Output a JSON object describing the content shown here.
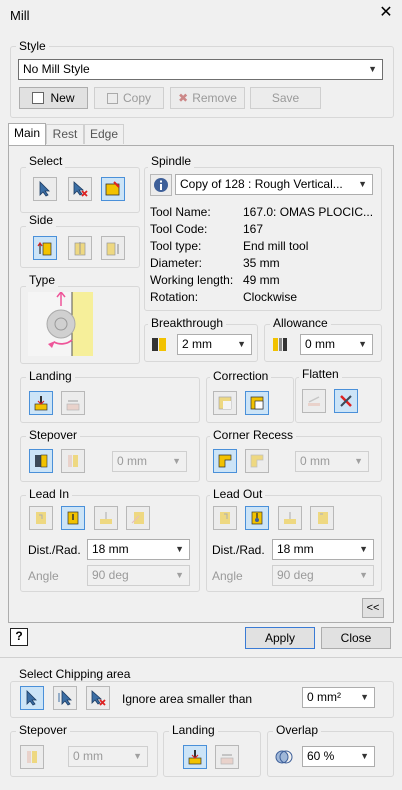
{
  "window": {
    "title": "Mill",
    "close": "✕"
  },
  "style": {
    "label": "Style",
    "selected": "No Mill Style",
    "buttons": {
      "new": "New",
      "copy": "Copy",
      "remove": "Remove",
      "save": "Save"
    }
  },
  "tabs": [
    "Main",
    "Rest",
    "Edge"
  ],
  "select": {
    "label": "Select"
  },
  "side": {
    "label": "Side"
  },
  "type": {
    "label": "Type"
  },
  "spindle": {
    "label": "Spindle",
    "tool_selected": "Copy of 128 : Rough Vertical...",
    "info": [
      {
        "k": "Tool Name:",
        "v": "167.0: OMAS PLOCIC..."
      },
      {
        "k": "Tool Code:",
        "v": "167"
      },
      {
        "k": "Tool type:",
        "v": "End mill tool"
      },
      {
        "k": "Diameter:",
        "v": "35 mm"
      },
      {
        "k": "Working length:",
        "v": "49 mm"
      },
      {
        "k": "Rotation:",
        "v": "Clockwise"
      }
    ]
  },
  "breakthrough": {
    "label": "Breakthrough",
    "value": "2 mm"
  },
  "allowance": {
    "label": "Allowance",
    "value": "0 mm"
  },
  "landing": {
    "label": "Landing"
  },
  "correction": {
    "label": "Correction"
  },
  "flatten": {
    "label": "Flatten"
  },
  "stepover": {
    "label": "Stepover",
    "value": "0 mm"
  },
  "corner_recess": {
    "label": "Corner Recess",
    "value": "0 mm"
  },
  "lead_in": {
    "label": "Lead In",
    "dist_label": "Dist./Rad.",
    "dist_value": "18 mm",
    "angle_label": "Angle",
    "angle_value": "90 deg"
  },
  "lead_out": {
    "label": "Lead Out",
    "dist_label": "Dist./Rad.",
    "dist_value": "18 mm",
    "angle_label": "Angle",
    "angle_value": "90 deg"
  },
  "collapse": "<<",
  "help": "?",
  "apply": "Apply",
  "close": "Close",
  "chipping": {
    "label": "Select Chipping area",
    "ignore_label": "Ignore area smaller than",
    "ignore_value": "0 mm²"
  },
  "bottom_stepover": {
    "label": "Stepover",
    "value": "0 mm"
  },
  "bottom_landing": {
    "label": "Landing"
  },
  "overlap": {
    "label": "Overlap",
    "value": "60 %"
  },
  "colors": {
    "accent": "#3a7bd5",
    "selected_bg": "#cce4f7",
    "icon_yellow": "#f2c200"
  }
}
